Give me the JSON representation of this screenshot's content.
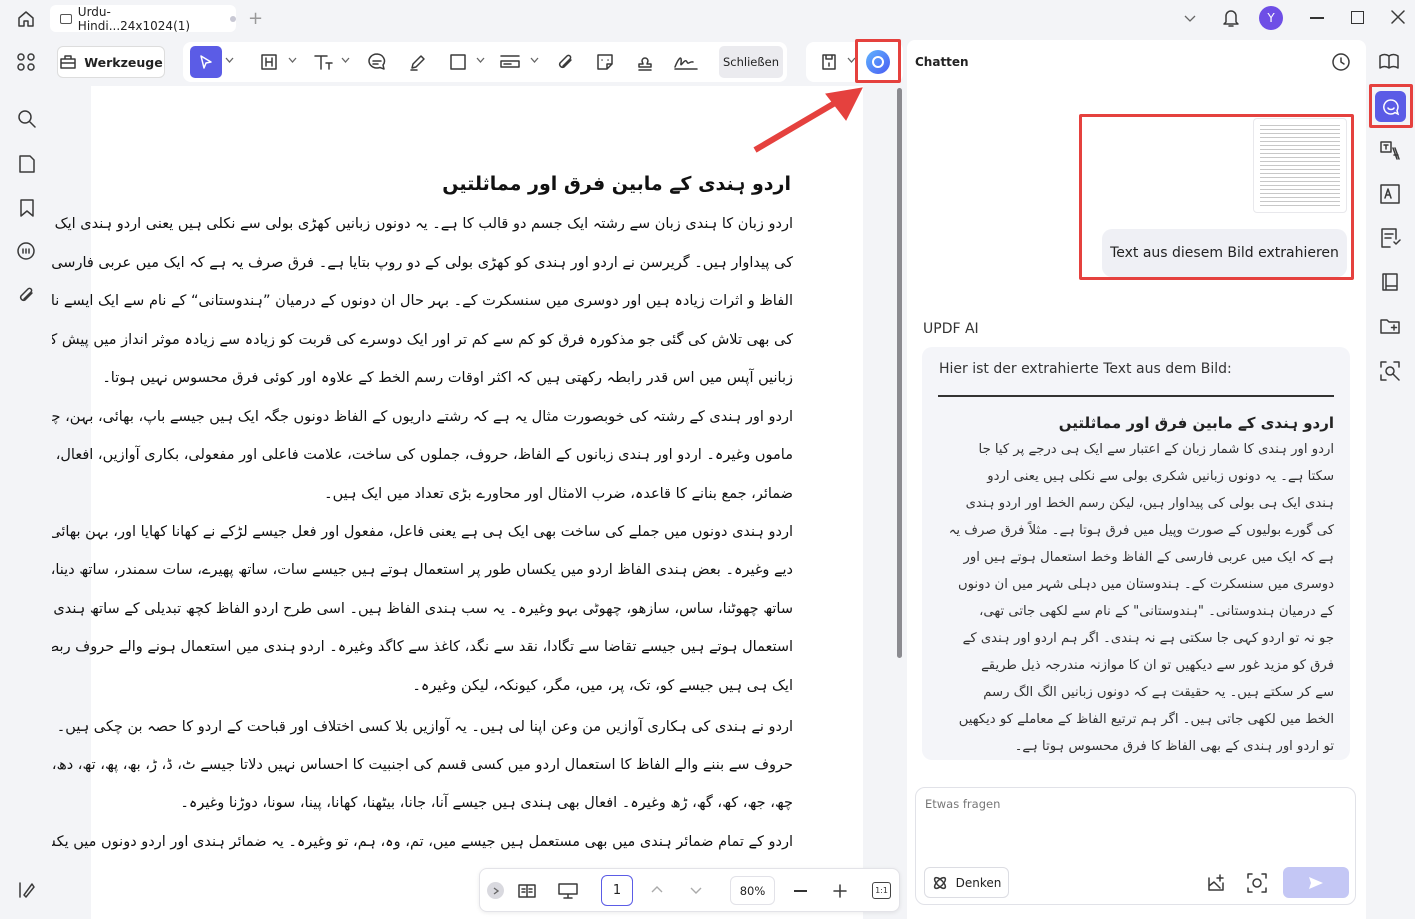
{
  "titlebar": {
    "tab_title": "Urdu-Hindi...24x1024(1)",
    "avatar_letter": "Y"
  },
  "toolbar": {
    "tools_label": "Werkzeuge",
    "close_label": "Schließen"
  },
  "document": {
    "heading": "اردو ہندی کے مابین فرق اور مماثلتیں",
    "lines": [
      "اردو زبان کا ہندی زبان سے رشتہ ایک جسم دو قالب کا ہے۔ یہ دونوں زبانیں کھڑی بولی سے نکلی ہیں یعنی اردو ہندی ایک ہی بطن",
      "کی پیداوار ہیں۔ گریرسن نے اردو اور ہندی کو کھڑی بولی کے دو روپ بتایا ہے۔ فرق صرف یہ ہے کہ ایک میں عربی فارسی کے",
      "الفاظ و اثرات زیادہ ہیں اور دوسری میں سنسکرت کے۔ بہر حال ان دونوں کے درمیان ”ہندوستانی“ کے نام سے ایک ایسے نام",
      "کی بھی تلاش کی گئی جو مذکورہ فرق کو کم سے کم تر اور ایک دوسرے کی قربت کو زیادہ سے زیادہ موثر انداز میں پیش کرتی ہے۔ یہ",
      "زبانیں آپس میں اس قدر رابطہ رکھتی ہیں کہ اکثر اوقات رسم الخط کے علاوہ اور کوئی فرق محسوس نہیں ہوتا۔",
      "اردو اور ہندی کے رشتہ کی خوبصورت مثال یہ ہے کہ رشتے داریوں کے الفاظ دونوں جگہ ایک ہیں جیسے باپ، بھائی، بہن، چچا،",
      "ماموں وغیرہ۔ اردو اور ہندی زبانوں کے الفاظ، حروف، جملوں کی ساخت، علامت فاعلی اور مفعولی، بکاری آوازیں، افعال،",
      "ضمائر، جمع بنانے کا قاعدہ، ضرب الامثال اور محاورے بڑی تعداد میں ایک ہیں۔",
      "اردو ہندی دونوں میں جملے کی ساخت بھی ایک ہی ہے یعنی فاعل، مفعول اور فعل جیسے لڑکے نے کھانا کھایا اور، بہن بھائی کو پیسے",
      "دیے وغیرہ۔ بعض ہندی الفاظ اردو میں یکساں طور پر استعمال ہوتے ہیں جیسے سات، ساتھ پھیرے، سات سمندر، ساتھ دینا،",
      "ساتھ چھوٹنا، ساس، سازھو، چھوٹی بہو وغیرہ۔ یہ سب ہندی الفاظ ہیں۔ اسی طرح اردو الفاظ کچھ تبدیلی کے ساتھ ہندی میں",
      "استعمال ہوتے ہیں جیسے تقاضا سے تگادا، نقد سے نگد، کاغذ سے کاگد وغیرہ۔ اردو ہندی میں استعمال ہونے والے حروف ربط بھی",
      "ایک ہی ہیں جیسے کو، تک، پر، میں، مگر، کیونکہ، لیکن وغیرہ۔",
      "اردو نے ہندی کی ہکاری آوازیں من وعن اپنا لی ہیں۔ یہ آوازیں بلا کسی اختلاف اور قباحت کے اردو کا حصہ بن چکی ہیں۔ ان",
      "حروف سے بننے والے الفاظ کا استعمال اردو میں کسی قسم کی اجنبیت کا احساس نہیں دلاتا جیسے ٹ، ڈ، ڑ، بھ، پھ، تھ، دھ، ڈھ، ٹھ،",
      "چھ، جھ، کھ، گھ، ڑھ وغیرہ۔ افعال بھی ہندی ہیں جیسے آنا، جانا، بیٹھنا، کھانا، پینا، سونا، دوڑنا وغیرہ۔",
      "اردو کے تمام ضمائر ہندی میں بھی مستعمل ہیں جیسے میں، تم، وہ، ہم، تو وغیرہ۔ یہ ضمائر ہندی اور اردو دونوں میں یکساں طور پر"
    ]
  },
  "pagebar": {
    "page": "1",
    "zoom": "80%"
  },
  "chat": {
    "header_label": "Chatten",
    "action_button": "Text aus diesem Bild extrahieren",
    "ai_name": "UPDF AI",
    "response_intro": "Hier ist der extrahierte Text aus dem Bild:",
    "response_heading": "اردو ہندی کے مابین فرق اور مماثلتیں",
    "response_lines": [
      "اردو اور ہندی کا شمار زبان کے اعتبار سے ایک ہی درجے پر کیا جا",
      "سکتا ہے۔ یہ دونوں زبانیں شکری بولی سے نکلی ہیں یعنی اردو",
      "ہندی ایک ہی بولی کی پیداوار ہیں، لیکن رسم الخط اور اردو ہندی",
      "کی گورے بولیوں کے صورت وپیل میں فرق ہوتا ہے۔ مثلاً فرق صرف یہ",
      "ہے کہ ایک میں عربی فارسی کے الفاظ وخط استعمال ہوتے ہیں اور",
      "دوسری میں سنسکرت کے۔ ہندوستان میں دہلی شہر میں ان دونوں",
      "کے درمیان ہندوستانی۔ \"ہندوستانی\" کے نام سے لکھی جاتی تھی،",
      "جو نہ تو اردو کہی جا سکتی ہے نہ ہندی۔ اگر ہم اردو اور ہندی کے",
      "فرق کو مزید غور سے دیکھیں تو ان کا موازنہ مندرجہ ذیل طریقے",
      "سے کر سکتے ہیں۔ یہ حقیقت ہے کہ دونوں زبانیں الگ الگ رسم",
      "الخط میں لکھی جاتی ہیں۔ اگر ہم ترتیع الفاظ کے معاملے کو دیکھیں",
      "تو اردو اور ہندی کے بھی الفاظ کا فرق محسوس ہوتا ہے۔"
    ],
    "input_placeholder": "Etwas fragen",
    "think_label": "Denken"
  },
  "colors": {
    "accent": "#5b5ce6",
    "annotation_red": "#e5413e"
  }
}
